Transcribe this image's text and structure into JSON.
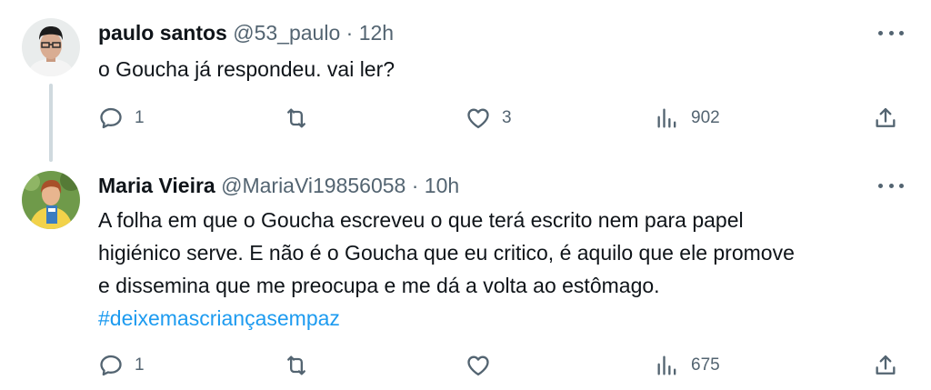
{
  "tweets": [
    {
      "author": {
        "name": "paulo santos",
        "handle": "@53_paulo",
        "separator": "·",
        "time": "12h"
      },
      "avatar_icon": "person-avatar",
      "text_lines": [
        "o Goucha já respondeu. vai ler?"
      ],
      "hashtag": "",
      "stats": {
        "replies": "1",
        "retweets": "",
        "likes": "3",
        "views": "902"
      }
    },
    {
      "author": {
        "name": "Maria Vieira",
        "handle": "@MariaVi19856058",
        "separator": "·",
        "time": "10h"
      },
      "avatar_icon": "person-avatar",
      "text_lines": [
        "A folha em que o Goucha escreveu o que terá escrito nem para papel",
        "higiénico serve. E não é o Goucha que eu critico, é aquilo que ele promove",
        "e dissemina que me  preocupa e me dá a volta ao estômago."
      ],
      "hashtag": "#deixemascriançasempaz",
      "stats": {
        "replies": "1",
        "retweets": "",
        "likes": "",
        "views": "675"
      }
    }
  ],
  "icons": {
    "reply": "reply-icon",
    "retweet": "retweet-icon",
    "like": "heart-icon",
    "views": "views-icon",
    "share": "share-icon",
    "more": "more-icon"
  },
  "colors": {
    "text": "#0f1419",
    "secondary": "#536471",
    "link": "#1d9bf0",
    "thread_line": "#cfd9de"
  }
}
